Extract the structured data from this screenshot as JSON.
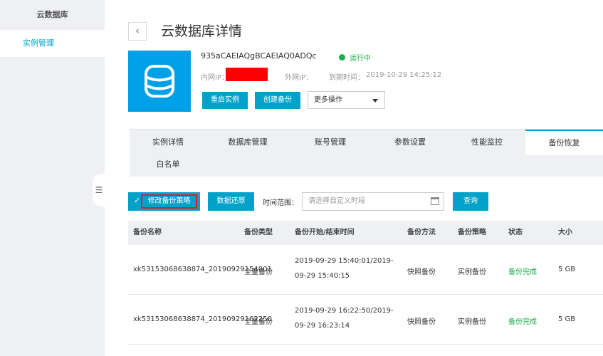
{
  "sidebar": {
    "title": "云数据库",
    "items": [
      {
        "label": "实例管理"
      }
    ]
  },
  "toggle_icon": "menu-icon",
  "header": {
    "back_icon": "chevron-left-icon",
    "title": "云数据库详情"
  },
  "instance": {
    "icon": "database-icon",
    "id": "935aCAEIAQgBCAEIAQ0ADQc",
    "status": "运行中",
    "status_color": "#1bae4c",
    "intranet_ip_label": "内网IP：",
    "public_ip_label": "外网IP：",
    "expire_label": "到期时间：",
    "expire_time": "2019-10-29 14:25:12"
  },
  "actions": {
    "restart": "重启实例",
    "create_backup": "创建备份",
    "more": "更多操作"
  },
  "tabs": [
    {
      "label": "实例详情"
    },
    {
      "label": "数据库管理"
    },
    {
      "label": "账号管理"
    },
    {
      "label": "参数设置"
    },
    {
      "label": "性能监控"
    },
    {
      "label": "备份恢复",
      "active": true
    },
    {
      "label": "白名单"
    }
  ],
  "toolbar": {
    "modify_policy": "修改备份策略",
    "restore": "数据还原",
    "range_label": "时间范围：",
    "range_placeholder": "请选择自定义时段",
    "query": "查询"
  },
  "table": {
    "columns": [
      "备份名称",
      "备份类型",
      "备份开始/结束时间",
      "备份方法",
      "备份策略",
      "状态",
      "大小"
    ],
    "rows": [
      {
        "name": "xk53153068638874_20190929154001",
        "type": "全量备份",
        "time_line1": "2019-09-29 15:40:01/2019-",
        "time_line2": "09-29 15:40:15",
        "method": "快照备份",
        "policy": "实例备份",
        "status": "备份完成",
        "size": "5 GB"
      },
      {
        "name": "xk53153068638874_20190929162250",
        "type": "全量备份",
        "time_line1": "2019-09-29 16:22:50/2019-",
        "time_line2": "09-29 16:23:14",
        "method": "快照备份",
        "policy": "实例备份",
        "status": "备份完成",
        "size": "5 GB"
      }
    ]
  },
  "colors": {
    "accent": "#00a2ca",
    "tile": "#00a0e9",
    "redaction": "#ff0000",
    "highlight_border": "#e02020"
  }
}
